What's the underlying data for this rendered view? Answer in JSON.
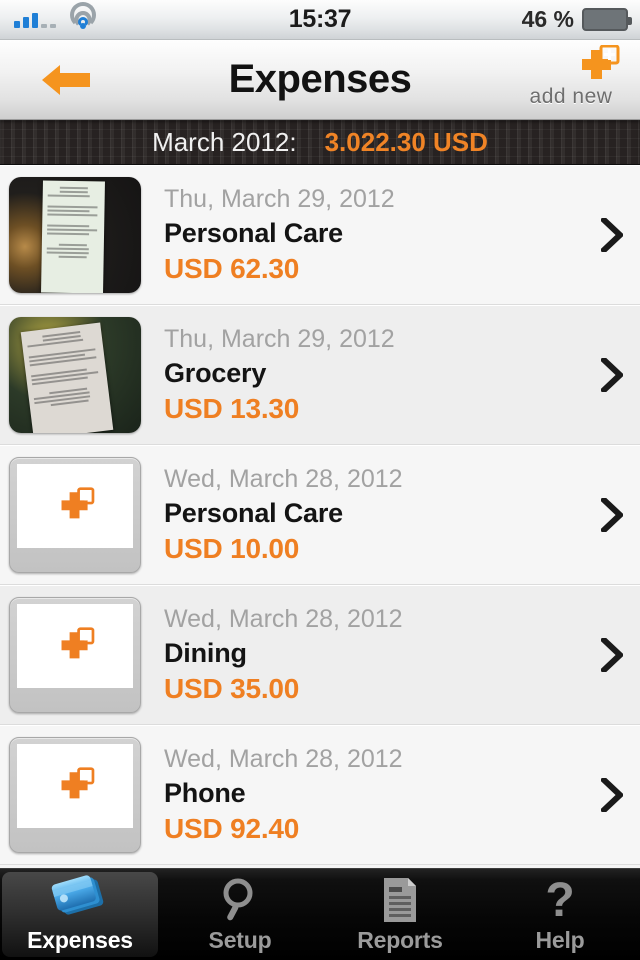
{
  "status_bar": {
    "signal_icon": "signal-bars-icon",
    "wifi_icon": "wifi-icon",
    "time": "15:37",
    "battery_percent": "46 %",
    "battery_level": 46,
    "battery_icon": "battery-icon"
  },
  "navbar": {
    "back_icon": "back-arrow-icon",
    "title": "Expenses",
    "add_label": "add new",
    "add_icon": "add-new-puzzle-icon"
  },
  "summary": {
    "period_label": "March 2012:",
    "total": "3.022.30 USD"
  },
  "colors": {
    "accent_orange": "#ef7f22",
    "summary_orange": "#f08426",
    "date_gray": "#a2a2a2",
    "tab_active_text": "#ffffff"
  },
  "expenses": [
    {
      "date": "Thu, March 29, 2012",
      "category": "Personal Care",
      "amount": "USD 62.30",
      "thumb_type": "photo",
      "thumb_name": "receipt-photo-thumbnail",
      "chevron_icon": "chevron-right-icon"
    },
    {
      "date": "Thu, March 29, 2012",
      "category": "Grocery",
      "amount": "USD 13.30",
      "thumb_type": "photo",
      "thumb_name": "receipt-photo-thumbnail",
      "chevron_icon": "chevron-right-icon"
    },
    {
      "date": "Wed, March 28, 2012",
      "category": "Personal Care",
      "amount": "USD 10.00",
      "thumb_type": "placeholder",
      "thumb_name": "placeholder-puzzle-thumbnail",
      "chevron_icon": "chevron-right-icon"
    },
    {
      "date": "Wed, March 28, 2012",
      "category": "Dining",
      "amount": "USD 35.00",
      "thumb_type": "placeholder",
      "thumb_name": "placeholder-puzzle-thumbnail",
      "chevron_icon": "chevron-right-icon"
    },
    {
      "date": "Wed, March 28, 2012",
      "category": "Phone",
      "amount": "USD 92.40",
      "thumb_type": "placeholder",
      "thumb_name": "placeholder-puzzle-thumbnail",
      "chevron_icon": "chevron-right-icon"
    }
  ],
  "tabs": [
    {
      "label": "Expenses",
      "icon": "expenses-cards-icon",
      "active": true
    },
    {
      "label": "Setup",
      "icon": "magnifier-icon",
      "active": false
    },
    {
      "label": "Reports",
      "icon": "document-icon",
      "active": false
    },
    {
      "label": "Help",
      "icon": "question-mark-icon",
      "active": false
    }
  ]
}
